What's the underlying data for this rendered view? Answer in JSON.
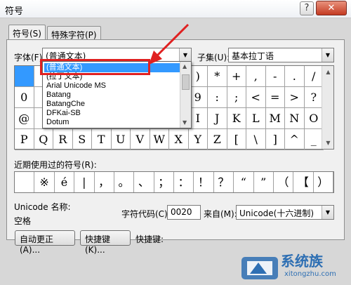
{
  "window": {
    "title": "符号",
    "help": "?",
    "close": "✕"
  },
  "tabs": [
    {
      "label": "符号(S)"
    },
    {
      "label": "特殊字符(P)"
    }
  ],
  "font": {
    "label": "字体(F):",
    "value": "(普通文本)"
  },
  "subset": {
    "label": "子集(U):",
    "value": "基本拉丁语"
  },
  "font_list": [
    "(普通文本)",
    "(拉丁文本)",
    "Arial Unicode MS",
    "Batang",
    "BatangChe",
    "DFKai-SB",
    "Dotum"
  ],
  "symbol_rows": [
    [
      "",
      "",
      "",
      "",
      "",
      "",
      "",
      "",
      "",
      ")",
      "*",
      "+",
      ",",
      "-",
      ".",
      "/"
    ],
    [
      "0",
      "",
      "",
      "",
      "",
      "",
      "",
      "",
      "",
      "9",
      ":",
      ";",
      "<",
      "=",
      ">",
      "?"
    ],
    [
      "@",
      "",
      "",
      "",
      "",
      "",
      "",
      "",
      "",
      "I",
      "J",
      "K",
      "L",
      "M",
      "N",
      "O"
    ],
    [
      "P",
      "Q",
      "R",
      "S",
      "T",
      "U",
      "V",
      "W",
      "X",
      "Y",
      "Z",
      "[",
      "\\",
      "]",
      "^",
      "_"
    ]
  ],
  "recent": {
    "label": "近期使用过的符号(R):",
    "symbols": [
      "",
      "※",
      "é",
      "|",
      "，",
      "。",
      "、",
      "；",
      "：",
      "！",
      "？",
      "“",
      "”",
      "（",
      "【",
      "）"
    ]
  },
  "unicode_name": {
    "label": "Unicode 名称:",
    "value": "空格"
  },
  "char_code": {
    "label": "字符代码(C):",
    "value": "0020"
  },
  "from": {
    "label": "来自(M):",
    "value": "Unicode(十六进制)"
  },
  "buttons": {
    "autocorrect": "自动更正(A)...",
    "shortcut": "快捷键(K)...",
    "shortcut_label": "快捷键:"
  },
  "watermark": {
    "text": "系统族",
    "url": "xitongzhu.com"
  },
  "colors": {
    "accent": "#3399ff",
    "highlight_box": "#e02020"
  }
}
